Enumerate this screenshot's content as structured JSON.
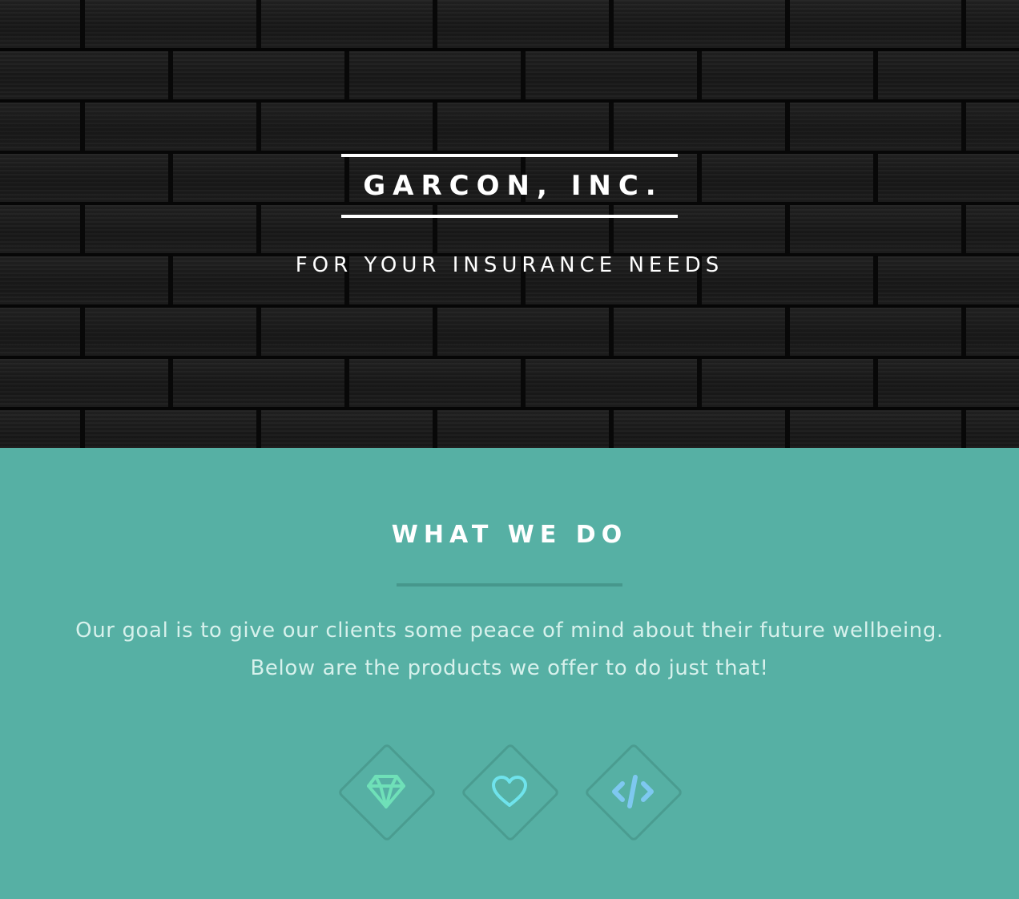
{
  "hero": {
    "title": "GARCON, INC.",
    "tagline": "FOR YOUR INSURANCE NEEDS"
  },
  "services": {
    "heading": "WHAT WE DO",
    "description_line1": "Our goal is to give our clients some peace of mind about their future wellbeing.",
    "description_line2": "Below are the products we offer to do just that!",
    "icons": [
      "diamond-icon",
      "heart-icon",
      "code-icon"
    ]
  },
  "colors": {
    "services_background": "#56b0a4",
    "diamond_icon": "#6fe0b8",
    "heart_icon": "#6fe3ec",
    "code_icon": "#7ec8f0"
  }
}
